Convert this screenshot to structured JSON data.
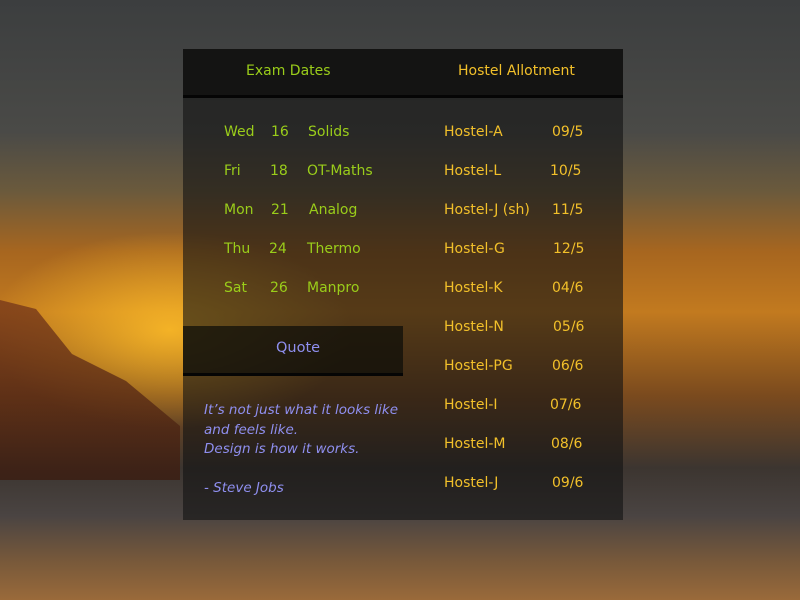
{
  "header": {
    "exam_title": "Exam Dates",
    "hostel_title": "Hostel Allotment"
  },
  "exams": [
    {
      "day": "Wed",
      "date": "16",
      "subject": "Solids"
    },
    {
      "day": "Fri",
      "date": "18",
      "subject": "OT-Maths"
    },
    {
      "day": "Mon",
      "date": "21",
      "subject": "Analog"
    },
    {
      "day": "Thu",
      "date": "24",
      "subject": "Thermo"
    },
    {
      "day": "Sat",
      "date": "26",
      "subject": "Manpro"
    }
  ],
  "hostels": [
    {
      "name": "Hostel-A",
      "date": "09/5"
    },
    {
      "name": "Hostel-L",
      "date": "10/5"
    },
    {
      "name": "Hostel-J (sh)",
      "date": "11/5"
    },
    {
      "name": "Hostel-G",
      "date": "12/5"
    },
    {
      "name": "Hostel-K",
      "date": "04/6"
    },
    {
      "name": "Hostel-N",
      "date": "05/6"
    },
    {
      "name": "Hostel-PG",
      "date": "06/6"
    },
    {
      "name": "Hostel-I",
      "date": "07/6"
    },
    {
      "name": "Hostel-M",
      "date": "08/6"
    },
    {
      "name": "Hostel-J",
      "date": "09/6"
    }
  ],
  "quote": {
    "title": "Quote",
    "lines": [
      "It’s not just what it looks like",
      "and feels like.",
      "Design is how it works."
    ],
    "author": "- Steve Jobs"
  },
  "colors": {
    "exam": "#9acd1a",
    "hostel": "#f2c02a",
    "quote": "#8f8fef"
  }
}
